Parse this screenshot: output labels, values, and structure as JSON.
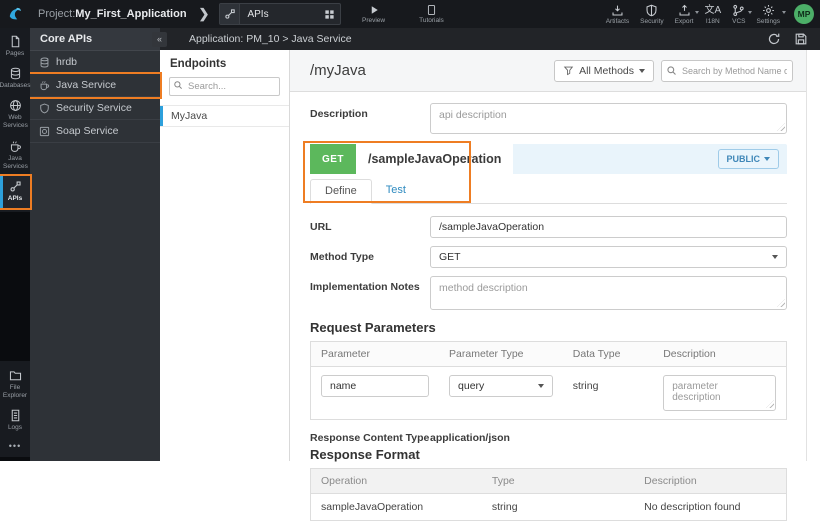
{
  "topbar": {
    "project_label": "Project:",
    "project_name": "My_First_Application",
    "tab_label": "APIs",
    "preview_label": "Preview",
    "tutorials_label": "Tutorials",
    "artifacts_label": "Artifacts",
    "security_label": "Security",
    "export_label": "Export",
    "i18n_label": "I18N",
    "i18n_glyph": "文A",
    "vcs_label": "VCS",
    "settings_label": "Settings",
    "avatar_initials": "MP"
  },
  "sidebar": {
    "items": [
      {
        "label": "Pages",
        "icon": "pages-icon",
        "active": false
      },
      {
        "label": "Databases",
        "icon": "databases-icon",
        "active": false
      },
      {
        "label": "Web Services",
        "icon": "web-services-icon",
        "active": false
      },
      {
        "label": "Java Services",
        "icon": "java-services-icon",
        "active": false
      },
      {
        "label": "APIs",
        "icon": "apis-icon",
        "active": true,
        "highlighted": true
      }
    ],
    "bottom_items": [
      {
        "label": "File Explorer",
        "icon": "file-explorer-icon"
      },
      {
        "label": "Logs",
        "icon": "logs-icon"
      }
    ]
  },
  "core_apis": {
    "title": "Core APIs",
    "items": [
      {
        "label": "hrdb",
        "icon": "database-icon",
        "highlighted": false
      },
      {
        "label": "Java Service",
        "icon": "java-icon",
        "highlighted": true
      },
      {
        "label": "Security Service",
        "icon": "shield-icon",
        "highlighted": false
      },
      {
        "label": "Soap Service",
        "icon": "soap-icon",
        "highlighted": false
      }
    ]
  },
  "breadcrumb": {
    "text": "Application: PM_10 > Java Service"
  },
  "endpoints": {
    "title": "Endpoints",
    "search_placeholder": "Search...",
    "items": [
      {
        "label": "MyJava",
        "selected": true
      }
    ]
  },
  "api": {
    "title": "/myJava",
    "filter_label": "All Methods",
    "search_placeholder": "Search by Method Name or URL...",
    "description_label": "Description",
    "description_placeholder": "api description",
    "method": {
      "verb": "GET",
      "path": "/sampleJavaOperation",
      "visibility_label": "PUBLIC",
      "tab_define": "Define",
      "tab_test": "Test",
      "url_label": "URL",
      "url_value": "/sampleJavaOperation",
      "method_type_label": "Method Type",
      "method_type_value": "GET",
      "impl_notes_label": "Implementation Notes",
      "impl_notes_placeholder": "method description",
      "request_params": {
        "title": "Request Parameters",
        "columns": [
          "Parameter",
          "Parameter Type",
          "Data Type",
          "Description"
        ],
        "rows": [
          {
            "parameter": "name",
            "parameter_type": "query",
            "data_type": "string",
            "description_placeholder": "parameter description"
          }
        ]
      },
      "response_content_type_label": "Response Content Type",
      "response_content_type_value": "application/json",
      "response_format": {
        "title": "Response Format",
        "columns": [
          "Operation",
          "Type",
          "Description"
        ],
        "rows": [
          {
            "operation": "sampleJavaOperation",
            "type": "string",
            "description": "No description found"
          }
        ]
      }
    }
  },
  "colors": {
    "annotation_orange": "#ee7d23",
    "get_green": "#5cb85c",
    "link_blue": "#2f8bc0",
    "active_bar_blue": "#2da0dc",
    "avatar_green": "#4caf68",
    "method_header_blue": "#e9f4fb"
  }
}
